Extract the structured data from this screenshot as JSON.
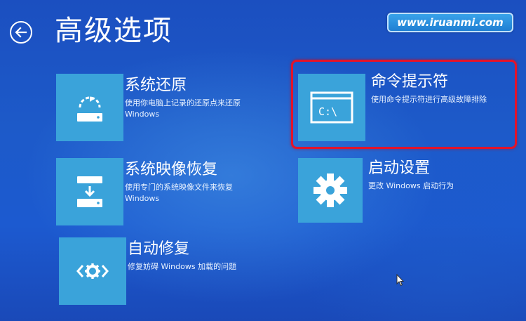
{
  "header": {
    "title": "高级选项",
    "back_icon": "back-arrow-icon",
    "watermark": "www.iruanmi.com"
  },
  "options": [
    {
      "key": "system-restore",
      "name": "系统还原",
      "desc_line1": "使用你电脑上记录的还原点来还原",
      "desc_line2": "Windows",
      "icon": "restore-icon"
    },
    {
      "key": "system-image-recovery",
      "name": "系统映像恢复",
      "desc_line1": "使用专门的系统映像文件来恢复",
      "desc_line2": "Windows",
      "icon": "image-recovery-icon"
    },
    {
      "key": "startup-repair",
      "name": "自动修复",
      "desc_line1": "修复妨碍 Windows 加载的问题",
      "desc_line2": "",
      "icon": "repair-icon"
    },
    {
      "key": "command-prompt",
      "name": "命令提示符",
      "desc_line1": "使用命令提示符进行高级故障排除",
      "desc_line2": "",
      "icon": "command-prompt-icon",
      "icon_text": "C:\\"
    },
    {
      "key": "startup-settings",
      "name": "启动设置",
      "desc_line1": "更改 Windows 启动行为",
      "desc_line2": "",
      "icon": "gear-icon"
    }
  ],
  "highlight": {
    "target": "command-prompt",
    "color": "#e3132a"
  },
  "colors": {
    "background": "#1d55c6",
    "tile": "#3aa3da",
    "text": "#ffffff"
  }
}
